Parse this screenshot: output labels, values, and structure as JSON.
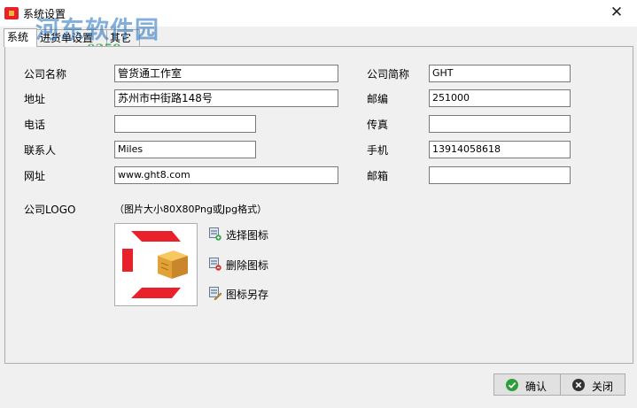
{
  "window": {
    "title": "系统设置",
    "close_glyph": "✕",
    "icon": "app-logo-icon"
  },
  "watermark": {
    "text": "河东软件园",
    "url": "www.pc0359.cn"
  },
  "tabs": [
    {
      "label": "系统"
    },
    {
      "label": "进货单设置"
    },
    {
      "label": "其它"
    }
  ],
  "form": {
    "company_name": {
      "label": "公司名称",
      "value": "管货通工作室"
    },
    "short_name": {
      "label": "公司简称",
      "value": "GHT"
    },
    "address": {
      "label": "地址",
      "value": "苏州市中街路148号"
    },
    "postcode": {
      "label": "邮编",
      "value": "251000"
    },
    "phone": {
      "label": "电话",
      "value": ""
    },
    "fax": {
      "label": "传真",
      "value": ""
    },
    "contact": {
      "label": "联系人",
      "value": "Miles"
    },
    "mobile": {
      "label": "手机",
      "value": "13914058618"
    },
    "website": {
      "label": "网址",
      "value": "www.ght8.com"
    },
    "email": {
      "label": "邮箱",
      "value": ""
    }
  },
  "logo": {
    "label": "公司LOGO",
    "hint": "（图片大小80X80Png或Jpg格式）",
    "actions": [
      {
        "label": "选择图标",
        "icon": "image-add-icon"
      },
      {
        "label": "删除图标",
        "icon": "image-delete-icon"
      },
      {
        "label": "图标另存",
        "icon": "image-save-icon"
      }
    ]
  },
  "footer": {
    "ok_label": "确认",
    "close_label": "关闭"
  },
  "colors": {
    "ok_icon": "#2e9e3a",
    "close_icon": "#333333",
    "logo_red": "#e8212b",
    "logo_box": "#f3b33d"
  }
}
